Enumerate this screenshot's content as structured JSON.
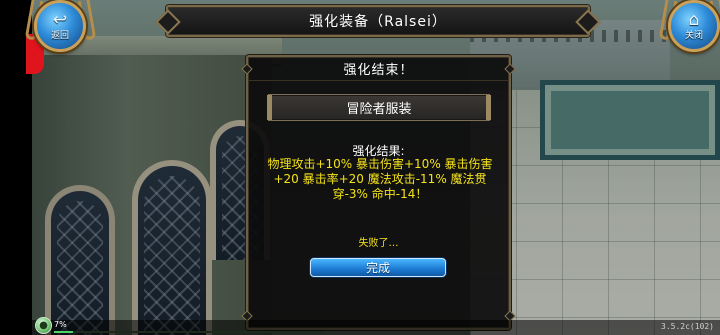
{
  "title_bar": {
    "text": "强化装备（Ralsei）"
  },
  "corner_buttons": {
    "back": {
      "label": "返回",
      "icon": "back-arrow-icon"
    },
    "close": {
      "label": "关闭",
      "icon": "home-icon"
    }
  },
  "dialog": {
    "title": "强化结束！",
    "item_name": "冒险者服装",
    "result_label": "强化结果:",
    "result_text": "物理攻击+10% 暴击伤害+10% 暴击伤害+20 暴击率+20 魔法攻击-11% 魔法贯穿-3% 命中-14！",
    "fail_text": "失败了…",
    "done_button": "完成"
  },
  "status": {
    "percent": "7%",
    "progress": 0.07,
    "version": "3.5.2c(102)"
  },
  "colors": {
    "highlight_text": "#f4e21a",
    "button_blue": "#1f7ed6",
    "frame_gold": "#7b6a4a"
  }
}
